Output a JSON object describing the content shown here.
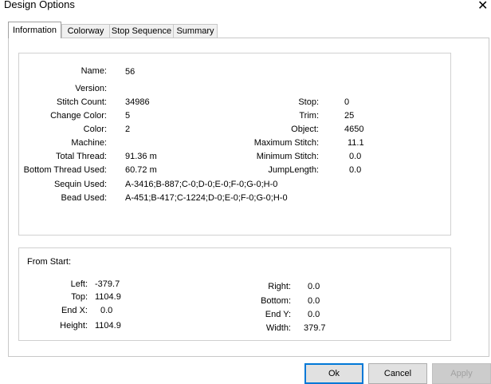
{
  "window": {
    "title": "Design Options",
    "close_glyph": "✕"
  },
  "tabs": [
    {
      "label": "Information"
    },
    {
      "label": "Colorway"
    },
    {
      "label": "Stop Sequence"
    },
    {
      "label": "Summary"
    }
  ],
  "info": {
    "name": {
      "label": "Name:",
      "value": "56"
    },
    "version": {
      "label": "Version:",
      "value": ""
    },
    "stitch_count": {
      "label": "Stitch Count:",
      "value": "34986"
    },
    "change_color": {
      "label": "Change Color:",
      "value": "5"
    },
    "color": {
      "label": "Color:",
      "value": "2"
    },
    "machine": {
      "label": "Machine:",
      "value": ""
    },
    "total_thread": {
      "label": "Total Thread:",
      "value": "91.36 m"
    },
    "bottom_thread": {
      "label": "Bottom Thread Used:",
      "value": "60.72 m"
    },
    "sequin": {
      "label": "Sequin Used:",
      "value": "A-3416;B-887;C-0;D-0;E-0;F-0;G-0;H-0"
    },
    "bead": {
      "label": "Bead Used:",
      "value": "A-451;B-417;C-1224;D-0;E-0;F-0;G-0;H-0"
    },
    "stop": {
      "label": "Stop:",
      "value": "0"
    },
    "trim": {
      "label": "Trim:",
      "value": "25"
    },
    "object": {
      "label": "Object:",
      "value": "4650"
    },
    "max_stitch": {
      "label": "Maximum Stitch:",
      "value": "11.1"
    },
    "min_stitch": {
      "label": "Minimum Stitch:",
      "value": "0.0"
    },
    "jump_length": {
      "label": "JumpLength:",
      "value": "0.0"
    }
  },
  "from_start": {
    "heading": "From Start:",
    "left": {
      "label": "Left:",
      "value": "-379.7"
    },
    "top": {
      "label": "Top:",
      "value": "1104.9"
    },
    "end_x": {
      "label": "End X:",
      "value": "0.0"
    },
    "height": {
      "label": "Height:",
      "value": "1104.9"
    },
    "right": {
      "label": "Right:",
      "value": "0.0"
    },
    "bottom": {
      "label": "Bottom:",
      "value": "0.0"
    },
    "end_y": {
      "label": "End Y:",
      "value": "0.0"
    },
    "width": {
      "label": "Width:",
      "value": "379.7"
    }
  },
  "buttons": {
    "ok": "Ok",
    "cancel": "Cancel",
    "apply": "Apply"
  }
}
